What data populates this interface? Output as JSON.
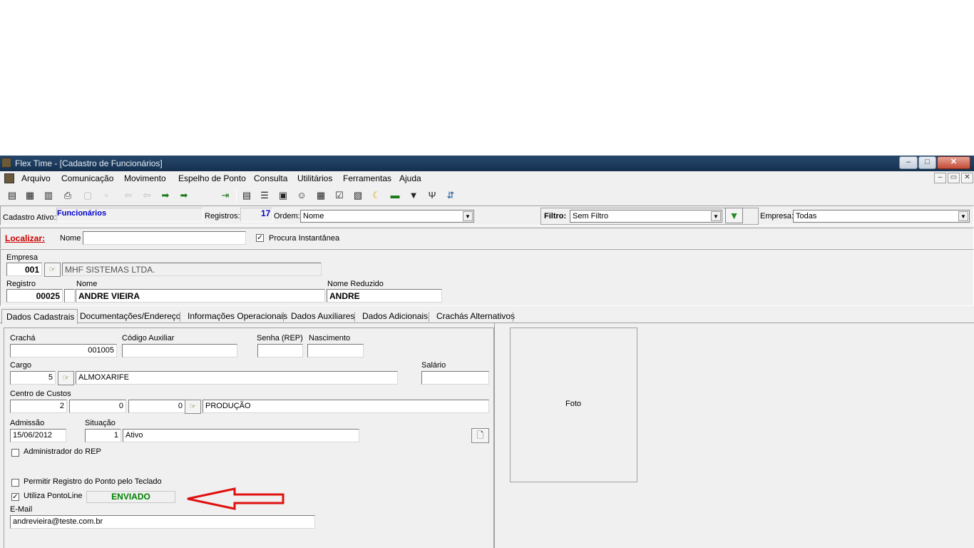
{
  "window": {
    "title": "Flex Time - [Cadastro de Funcionários]",
    "min": "–",
    "max": "□",
    "close": "✕"
  },
  "menu": {
    "items": [
      "Arquivo",
      "Comunicação",
      "Movimento",
      "Espelho de Ponto",
      "Consulta",
      "Utilitários",
      "Ferramentas",
      "Ajuda"
    ],
    "mdi_min": "–",
    "mdi_restore": "▭",
    "mdi_close": "✕"
  },
  "toolbar": {
    "icons": [
      "new-record-icon",
      "edit-record-icon",
      "list-icon",
      "print-icon",
      "save-icon",
      "cancel-icon",
      "first-icon",
      "prior-icon",
      "next-icon",
      "last-icon",
      "exit-icon",
      "report-icon",
      "sort-icon",
      "calculator-icon",
      "user-icon",
      "grid-icon",
      "check-icon",
      "calendar-icon",
      "moon-icon",
      "excel-icon",
      "filter-down-icon",
      "fork-icon",
      "export-icon"
    ],
    "glyphs": [
      "▤",
      "▦",
      "▥",
      "⎙",
      "▢",
      "▫",
      "⇦",
      "⇦",
      "➡",
      "➡",
      "⇥",
      "▤",
      "☰",
      "▣",
      "☺",
      "▦",
      "☑",
      "▧",
      "☾",
      "▬",
      "▼",
      "Ψ",
      "⇵"
    ]
  },
  "status": {
    "cadastro_label": "Cadastro Ativo:",
    "cadastro_value": "Funcionários",
    "registros_label": "Registros:",
    "registros_value": "17",
    "ordem_label": "Ordem:",
    "ordem_value": "Nome",
    "filtro_label": "Filtro:",
    "filtro_value": "Sem Filtro",
    "empresa_label": "Empresa:",
    "empresa_value": "Todas"
  },
  "search": {
    "localizar": "Localizar:",
    "nome_label": "Nome",
    "nome_value": "",
    "instant_label": "Procura Instantânea",
    "instant_checked": "✓"
  },
  "header": {
    "empresa_label": "Empresa",
    "empresa_code": "001",
    "empresa_name": "MHF SISTEMAS LTDA.",
    "registro_label": "Registro",
    "registro_value": "00025",
    "nome_label": "Nome",
    "nome_value": "ANDRE VIEIRA",
    "reduzido_label": "Nome Reduzido",
    "reduzido_value": "ANDRE"
  },
  "tabs": [
    "Dados Cadastrais",
    "Documentações/Endereço",
    "Informações Operacionais",
    "Dados Auxiliares",
    "Dados Adicionais",
    "Crachás Alternativos"
  ],
  "form": {
    "cracha_label": "Crachá",
    "cracha_value": "001005",
    "codaux_label": "Código Auxiliar",
    "codaux_value": "",
    "senha_label": "Senha (REP)",
    "senha_value": "",
    "nasc_label": "Nascimento",
    "nasc_value": "",
    "cargo_label": "Cargo",
    "cargo_code": "5",
    "cargo_name": "ALMOXARIFE",
    "salario_label": "Salário",
    "salario_value": "",
    "cc_label": "Centro de Custos",
    "cc_1": "2",
    "cc_2": "0",
    "cc_3": "0",
    "cc_name": "PRODUÇÃO",
    "admissao_label": "Admissão",
    "admissao_value": "15/06/2012",
    "situacao_label": "Situação",
    "situacao_code": "1",
    "situacao_name": "Ativo",
    "admin_rep_label": "Administrador do REP",
    "teclado_label": "Permitir Registro do Ponto pelo Teclado",
    "pontoline_label": "Utiliza PontoLine",
    "pontoline_checked": "✓",
    "pontoline_status": "ENVIADO",
    "email_label": "E-Mail",
    "email_value": "andrevieira@teste.com.br",
    "foto_label": "Foto"
  },
  "colors": {
    "accent_blue": "#0000cc",
    "localizar_red": "#cc0000",
    "enviado_green": "#008000",
    "arrow_red": "#e01010"
  }
}
